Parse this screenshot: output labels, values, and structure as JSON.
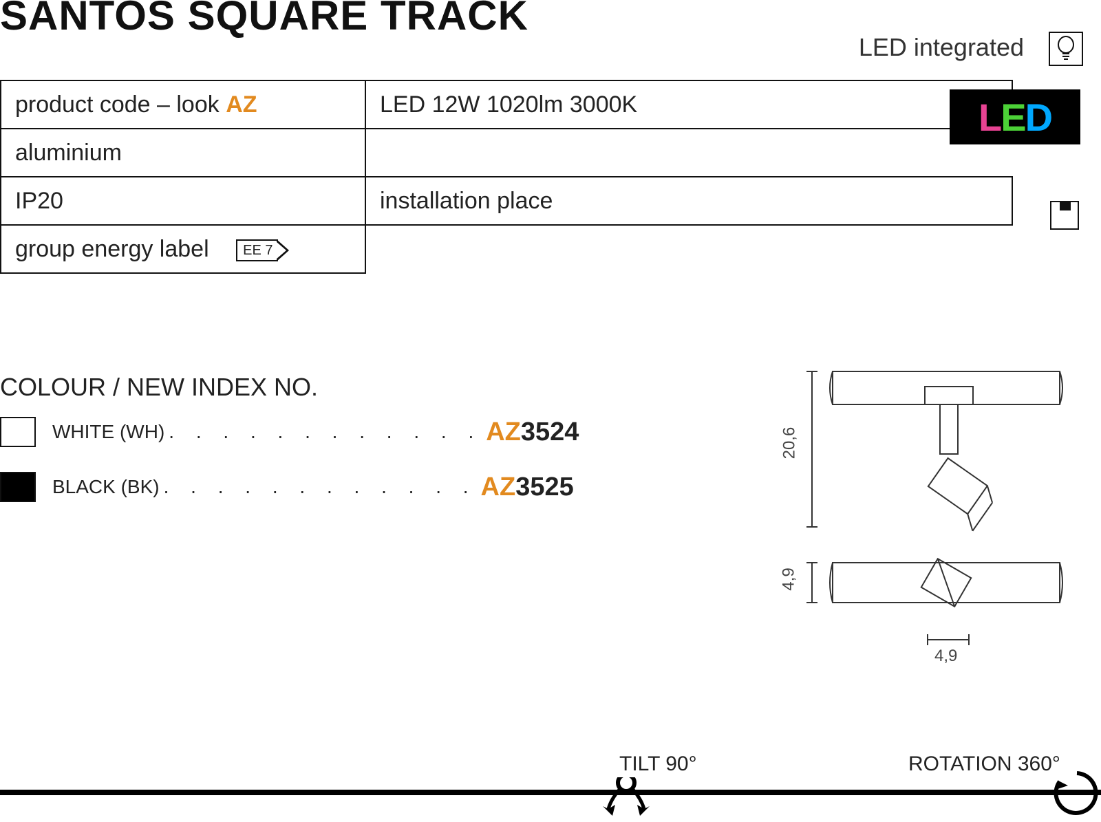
{
  "title": "SANTOS SQUARE TRACK",
  "led_integrated": "LED integrated",
  "table": {
    "product_code_label": "product code – look ",
    "product_code_az": "AZ",
    "led_spec": "LED 12W 1020lm 3000K",
    "material": "aluminium",
    "ip": "IP20",
    "install_label": "installation place",
    "energy_label": "group energy label",
    "energy_tag": "EE 7"
  },
  "led_tag": {
    "l": "L",
    "e": "E",
    "d": "D"
  },
  "colour": {
    "header": "COLOUR / NEW INDEX NO.",
    "rows": [
      {
        "name": "WHITE (WH)",
        "dots": ". . . . . . . . . . . .",
        "az": "AZ",
        "num": "3524",
        "swatch": "white"
      },
      {
        "name": "BLACK (BK)",
        "dots": ". . . . . . . . . . . .",
        "az": "AZ",
        "num": "3525",
        "swatch": "black"
      }
    ]
  },
  "dims": {
    "height": "20,6",
    "depth": "4,9",
    "width": "4,9"
  },
  "footer": {
    "tilt": "TILT 90°",
    "rotation": "ROTATION 360°"
  }
}
